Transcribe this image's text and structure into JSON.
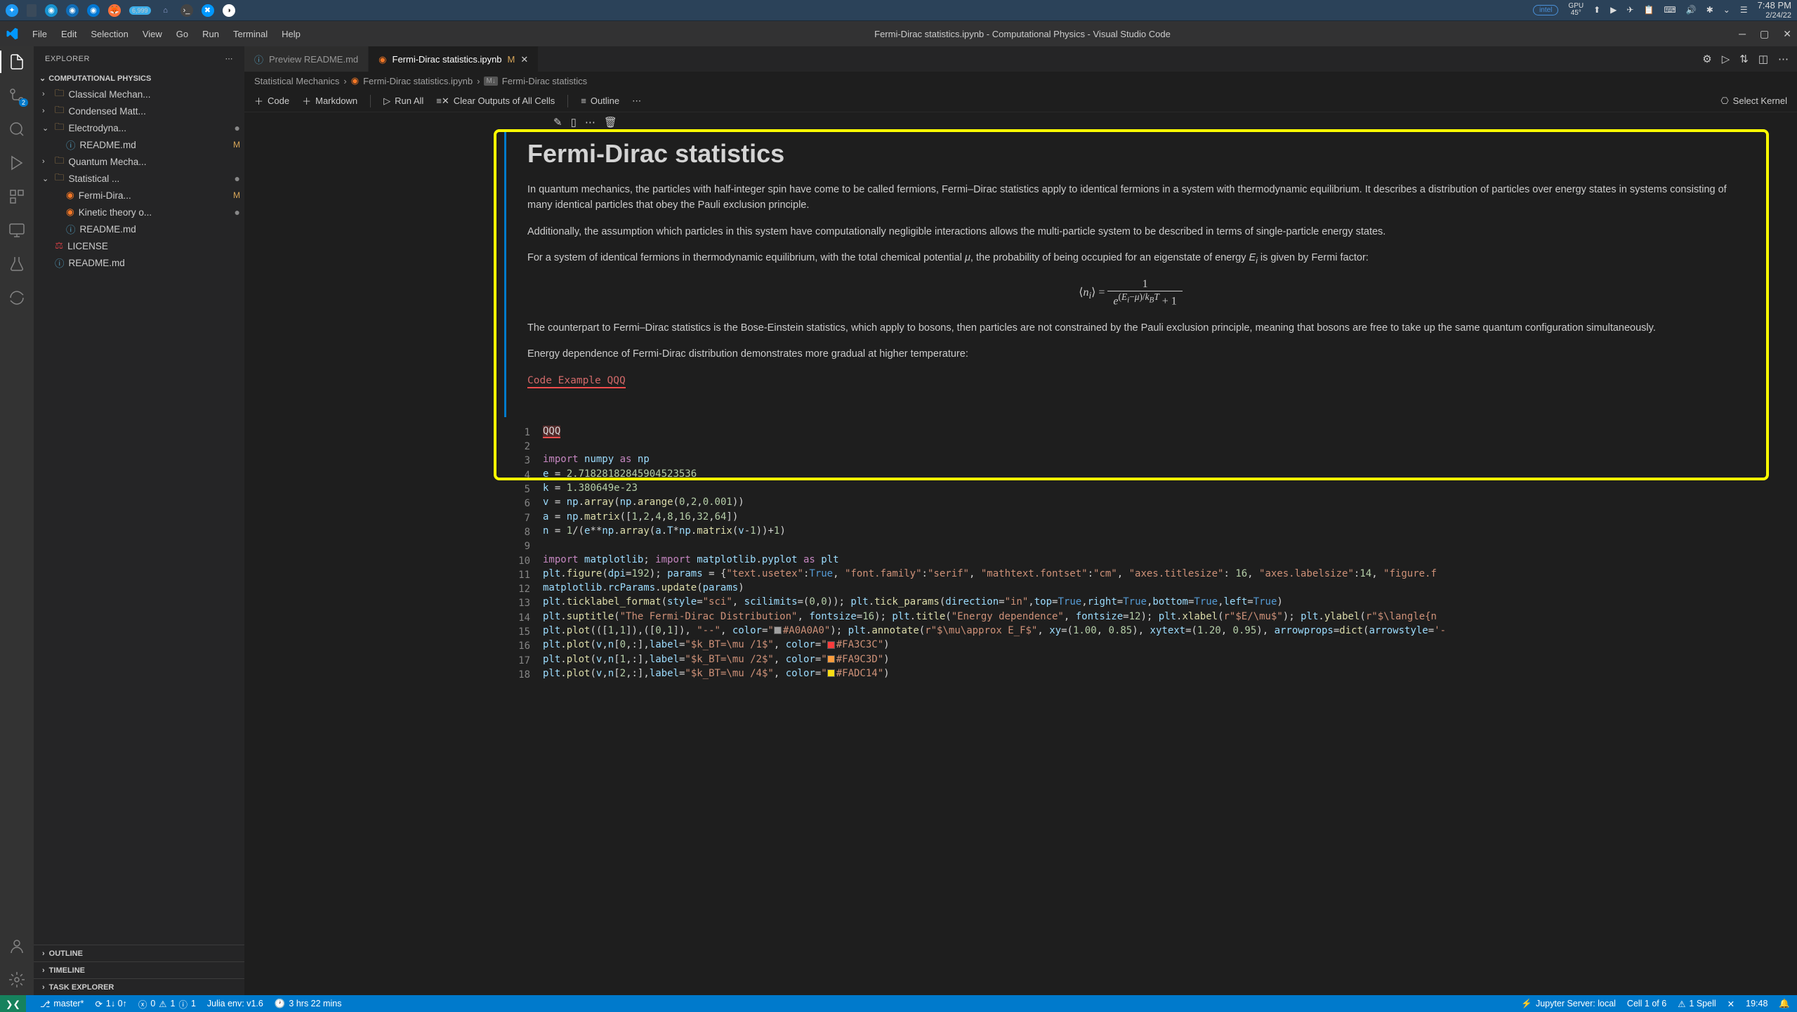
{
  "os_taskbar": {
    "gpu_label": "GPU",
    "gpu_temp": "45°",
    "intel": "intel",
    "time": "7:48 PM",
    "date": "2/24/22"
  },
  "titlebar": {
    "menus": [
      "File",
      "Edit",
      "Selection",
      "View",
      "Go",
      "Run",
      "Terminal",
      "Help"
    ],
    "title": "Fermi-Dirac statistics.ipynb - Computational Physics - Visual Studio Code"
  },
  "sidebar": {
    "header": "EXPLORER",
    "workspace": "COMPUTATIONAL PHYSICS",
    "tree": [
      {
        "type": "folder",
        "label": "Classical Mechan...",
        "indent": 0,
        "chev": "›"
      },
      {
        "type": "folder",
        "label": "Condensed Matt...",
        "indent": 0,
        "chev": "›"
      },
      {
        "type": "folder",
        "label": "Electrodyna...",
        "indent": 0,
        "chev": "⌄",
        "dot": true
      },
      {
        "type": "file",
        "label": "README.md",
        "indent": 1,
        "icon": "md",
        "mod": "M"
      },
      {
        "type": "folder",
        "label": "Quantum Mecha...",
        "indent": 0,
        "chev": "›"
      },
      {
        "type": "folder",
        "label": "Statistical ...",
        "indent": 0,
        "chev": "⌄",
        "dot": true
      },
      {
        "type": "file",
        "label": "Fermi-Dira...",
        "indent": 1,
        "icon": "jupyter",
        "mod": "M"
      },
      {
        "type": "file",
        "label": "Kinetic theory o...",
        "indent": 1,
        "icon": "jupyter",
        "dot": true
      },
      {
        "type": "file",
        "label": "README.md",
        "indent": 1,
        "icon": "md"
      },
      {
        "type": "file",
        "label": "LICENSE",
        "indent": 0,
        "icon": "lic"
      },
      {
        "type": "file",
        "label": "README.md",
        "indent": 0,
        "icon": "md"
      }
    ],
    "sections": [
      "OUTLINE",
      "TIMELINE",
      "TASK EXPLORER"
    ]
  },
  "tabs": {
    "items": [
      {
        "label": "Preview README.md",
        "icon": "md",
        "active": false
      },
      {
        "label": "Fermi-Dirac statistics.ipynb",
        "icon": "jupyter",
        "active": true,
        "mod": "M"
      }
    ]
  },
  "breadcrumb": {
    "parts": [
      "Statistical Mechanics",
      "Fermi-Dirac statistics.ipynb",
      "Fermi-Dirac statistics"
    ],
    "md_badge": "M↓"
  },
  "nb_toolbar": {
    "code": "Code",
    "markdown": "Markdown",
    "run_all": "Run All",
    "clear": "Clear Outputs of All Cells",
    "outline": "Outline",
    "kernel": "Select Kernel"
  },
  "markdown_cell": {
    "title": "Fermi-Dirac statistics",
    "p1": "In quantum mechanics, the particles with half-integer spin have come to be called fermions, Fermi–Dirac statistics apply to identical fermions in a system with thermodynamic equilibrium. It describes a distribution of particles over energy states in systems consisting of many identical particles that obey the Pauli exclusion principle.",
    "p2": "Additionally, the assumption which particles in this system have computationally negligible interactions allows the multi-particle system to be described in terms of single-particle energy states.",
    "p3a": "For a system of identical fermions in thermodynamic equilibrium, with the total chemical potential ",
    "p3b": ", the probability of being occupied for an eigenstate of energy ",
    "p3c": " is given by Fermi factor:",
    "p4": "The counterpart to Fermi–Dirac statistics is the Bose-Einstein statistics, which apply to bosons, then particles are not constrained by the Pauli exclusion principle, meaning that bosons are free to take up the same quantum configuration simultaneously.",
    "p5": "Energy dependence of Fermi-Dirac distribution demonstrates more gradual at higher temperature:",
    "err": "Code Example QQQ"
  },
  "code_cell": {
    "lines": 18
  },
  "statusbar": {
    "branch": "master*",
    "sync": "1↓ 0↑",
    "errors": "0",
    "warnings": "1",
    "info": "1",
    "julia": "Julia env: v1.6",
    "time": "3 hrs 22 mins",
    "jupyter": "Jupyter Server: local",
    "cell": "Cell 1 of 6",
    "spell": "1 Spell",
    "clock": "19:48"
  }
}
